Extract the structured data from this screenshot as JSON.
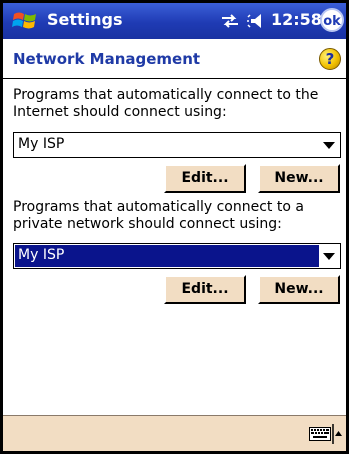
{
  "titlebar": {
    "title": "Settings",
    "clock": "12:58",
    "ok_label": "ok"
  },
  "header": {
    "page_title": "Network Management",
    "help_label": "?"
  },
  "internet": {
    "label": "Programs that automatically connect to the Internet should connect using:",
    "selected": "My ISP",
    "edit_label": "Edit...",
    "new_label": "New..."
  },
  "private": {
    "label": "Programs that automatically connect to a private network should connect using:",
    "selected": "My ISP",
    "edit_label": "Edit...",
    "new_label": "New..."
  },
  "icons": {
    "start": "windows-flag-icon",
    "connectivity": "connectivity-arrows-icon",
    "volume": "speaker-icon",
    "help": "help-icon",
    "keyboard": "keyboard-icon",
    "sip": "sip-up-arrow-icon"
  },
  "colors": {
    "titlebar": "#1f3bb4",
    "accent_text": "#1f3aa6",
    "selection": "#0a148c",
    "button_face": "#f2ddc3"
  }
}
